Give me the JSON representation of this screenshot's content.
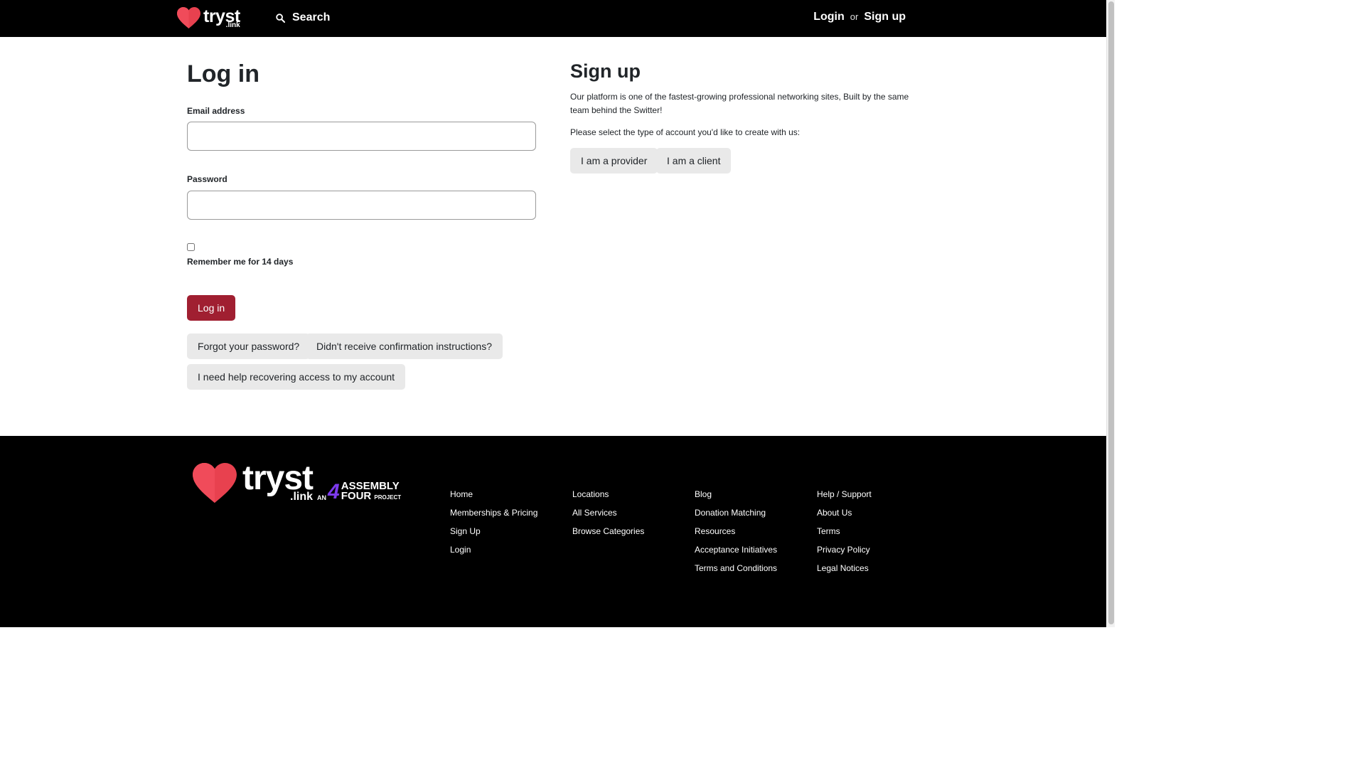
{
  "header": {
    "logo_word": "tryst",
    "logo_sub": ".link",
    "search_label": "Search",
    "login_label": "Login",
    "or_label": "or",
    "signup_label": "Sign up"
  },
  "login": {
    "title": "Log in",
    "email_label": "Email address",
    "email_value": "",
    "password_label": "Password",
    "password_value": "",
    "remember_label": "Remember me for 14 days",
    "remember_checked": false,
    "submit_label": "Log in",
    "forgot_label": "Forgot your password?",
    "confirm_label": "Didn't receive confirmation instructions?",
    "recover_label": "I need help recovering access to my account"
  },
  "signup": {
    "title": "Sign up",
    "description": "Our platform is one of the fastest-growing professional networking sites, Built by the same team behind the Switter!",
    "prompt": "Please select the type of account you'd like to create with us:",
    "provider_label": "I am a provider",
    "client_label": "I am a client"
  },
  "footer": {
    "logo_word": "tryst",
    "logo_sub": ".link",
    "assembly_an": "AN",
    "assembly_line1": "ASSEMBLY",
    "assembly_line2": "FOUR",
    "assembly_project": "PROJECT",
    "columns": [
      [
        "Home",
        "Memberships & Pricing",
        "Sign Up",
        "Login"
      ],
      [
        "Locations",
        "All Services",
        "Browse Categories"
      ],
      [
        "Blog",
        "Donation Matching",
        "Resources",
        "Acceptance Initiatives",
        "Terms and Conditions"
      ],
      [
        "Help / Support",
        "About Us",
        "Terms",
        "Privacy Policy",
        "Legal Notices"
      ]
    ]
  },
  "colors": {
    "brand_red": "#e8414f",
    "primary_button": "#a01f31",
    "assembly_purple": "#7c3aed",
    "header_bg": "#000000"
  }
}
